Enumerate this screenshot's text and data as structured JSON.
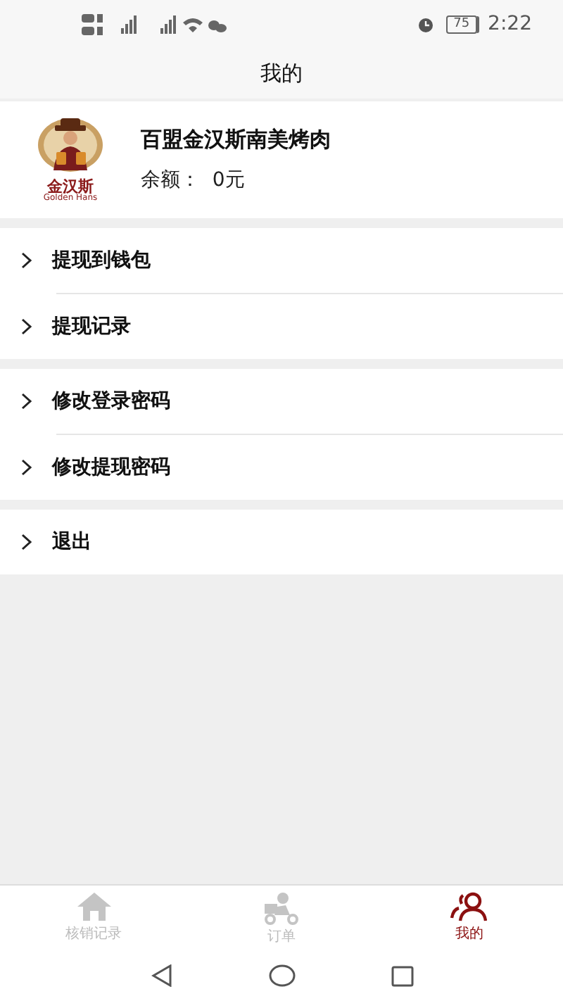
{
  "status_bar": {
    "battery": "75",
    "time": "2:22"
  },
  "header": {
    "title": "我的"
  },
  "profile": {
    "logo_text": "金汉斯",
    "logo_subtext": "Golden Hans",
    "name": "百盟金汉斯南美烤肉",
    "balance": "余额：  0元"
  },
  "menu_groups": [
    {
      "items": [
        {
          "label": "提现到钱包"
        },
        {
          "label": "提现记录"
        }
      ]
    },
    {
      "items": [
        {
          "label": "修改登录密码"
        },
        {
          "label": "修改提现密码"
        }
      ]
    },
    {
      "items": [
        {
          "label": "退出"
        }
      ]
    }
  ],
  "tab_bar": [
    {
      "kind": "home",
      "label": "核销记录",
      "selected": false
    },
    {
      "kind": "delivery",
      "label": "订单",
      "selected": false
    },
    {
      "kind": "people",
      "label": "我的",
      "selected": true
    }
  ]
}
